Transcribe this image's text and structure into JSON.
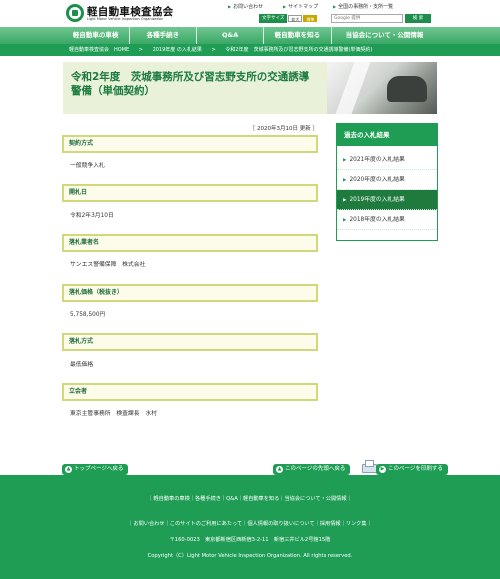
{
  "header": {
    "logo_jp": "軽自動車検査協会",
    "logo_en": "Light Motor Vehicle Inspection Organization",
    "links": [
      "お問い合わせ",
      "サイトマップ",
      "全国の事務所・支所一覧"
    ],
    "font_size_label": "文字サイズ",
    "font_size_options": [
      "標準",
      "拡大"
    ],
    "search_placeholder": "Google 提供",
    "search_button": "検 索"
  },
  "nav": {
    "items": [
      "軽自動車の車検",
      "各種手続き",
      "Q&A",
      "軽自動車を知る",
      "当協会について・公開情報"
    ]
  },
  "breadcrumb": {
    "items": [
      "軽自動車検査協会　HOME",
      "2019年度 の入札結果",
      "令和2年度　茨城事務所及び習志野支所の交通誘導警備(単価契約)"
    ],
    "separator": ">"
  },
  "main": {
    "title": "令和2年度　茨城事務所及び習志野支所の交通誘導警備（単価契約）",
    "date": "［ 2020年3月10日 更新 ］",
    "sections": [
      {
        "heading": "契約方式",
        "value": "一般競争入札"
      },
      {
        "heading": "開札日",
        "value": "令和2年3月10日"
      },
      {
        "heading": "落札業者名",
        "value": "サンエス警備保障　株式会社"
      },
      {
        "heading": "落札価格（税抜き）",
        "value": "5,758,500円"
      },
      {
        "heading": "落札方式",
        "value": "最低価格"
      },
      {
        "heading": "立会者",
        "value": "東京主管事務所　検査課長　水村"
      }
    ]
  },
  "sidebar": {
    "heading": "過去の入札結果",
    "items": [
      "2021年度の入札結果",
      "2020年度の入札結果",
      "2019年度の入札結果",
      "2018年度の入札結果"
    ],
    "active_index": 2
  },
  "page_actions": {
    "top": "トップページへ戻る",
    "page_top": "このページの先頭へ戻る",
    "print": "このページを印刷する"
  },
  "footer": {
    "links1": "｜軽自動車の車検｜各種手続き｜Q&A｜軽自動車を知る｜当協会について・公開情報｜",
    "links2": "｜お問い合わせ｜このサイトのご利用にあたって｜個人情報の取り扱いについて｜採用情報｜リンク集｜",
    "address": "〒160-0023　東京都新宿区西新宿3-2-11　新宿三井ビル2号館15階",
    "copyright": "Copyright（C）Light Motor Vehicle Inspection Organization. All rights reserved."
  },
  "colors": {
    "brand_green": "#1f9d55",
    "nav_green": "#3aa866",
    "section_border": "#cfd87a"
  }
}
